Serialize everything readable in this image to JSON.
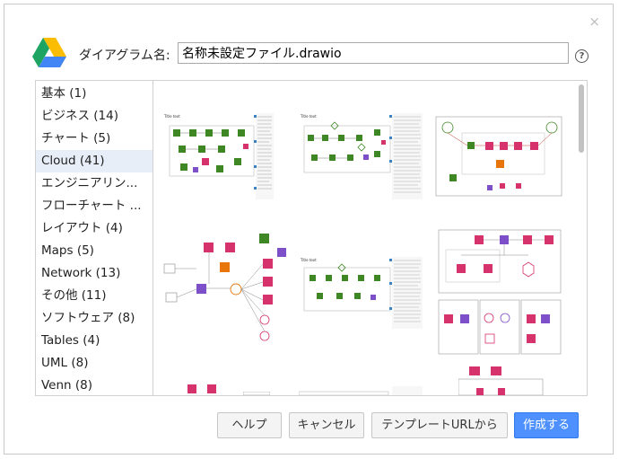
{
  "dialog": {
    "close_symbol": "×",
    "name_label": "ダイアグラム名:",
    "filename_value": "名称未設定ファイル.drawio",
    "help_symbol": "?"
  },
  "categories": [
    {
      "label": "基本 (1)"
    },
    {
      "label": "ビジネス (14)"
    },
    {
      "label": "チャート (5)"
    },
    {
      "label": "Cloud (41)"
    },
    {
      "label": "エンジニアリン..."
    },
    {
      "label": "フローチャート ..."
    },
    {
      "label": "レイアウト (4)"
    },
    {
      "label": "Maps (5)"
    },
    {
      "label": "Network (13)"
    },
    {
      "label": "その他 (11)"
    },
    {
      "label": "ソフトウェア (8)"
    },
    {
      "label": "Tables (4)"
    },
    {
      "label": "UML (8)"
    },
    {
      "label": "Venn (8)"
    }
  ],
  "selected_category": "Cloud (41)",
  "buttons": {
    "help": "ヘルプ",
    "cancel": "キャンセル",
    "template_url": "テンプレートURLから",
    "create": "作成する"
  },
  "colors": {
    "aws_green": "#3f8624",
    "aws_pink": "#d6336c",
    "aws_purple": "#7d4fc8",
    "aws_orange": "#e8750a",
    "primary_button": "#4d90fe"
  }
}
